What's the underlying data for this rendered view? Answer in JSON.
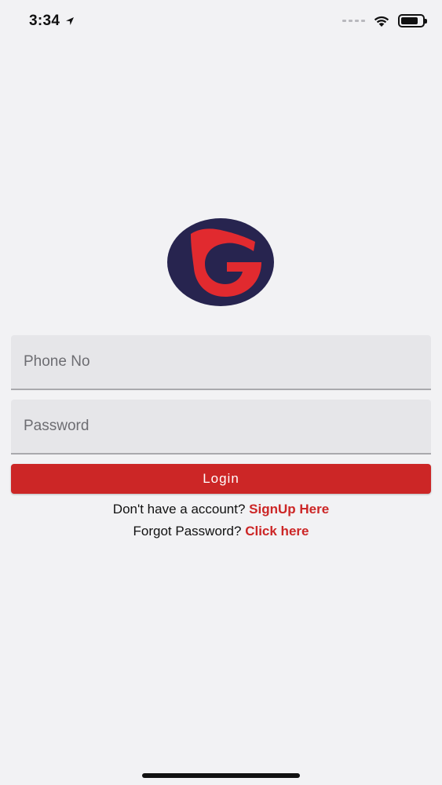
{
  "status_bar": {
    "time": "3:34"
  },
  "logo": {
    "letter_shape": "G",
    "colors": {
      "ring": "#27244f",
      "letter": "#e12a2f"
    }
  },
  "form": {
    "phone_placeholder": "Phone No",
    "password_placeholder": "Password",
    "login_label": "Login"
  },
  "links": {
    "signup_prompt": "Don't have a account?",
    "signup_link": "SignUp Here",
    "forgot_prompt": "Forgot Password?",
    "forgot_link": "Click here"
  },
  "colors": {
    "accent": "#cc2626",
    "background": "#f2f2f4",
    "field_background": "#e6e6e9"
  }
}
